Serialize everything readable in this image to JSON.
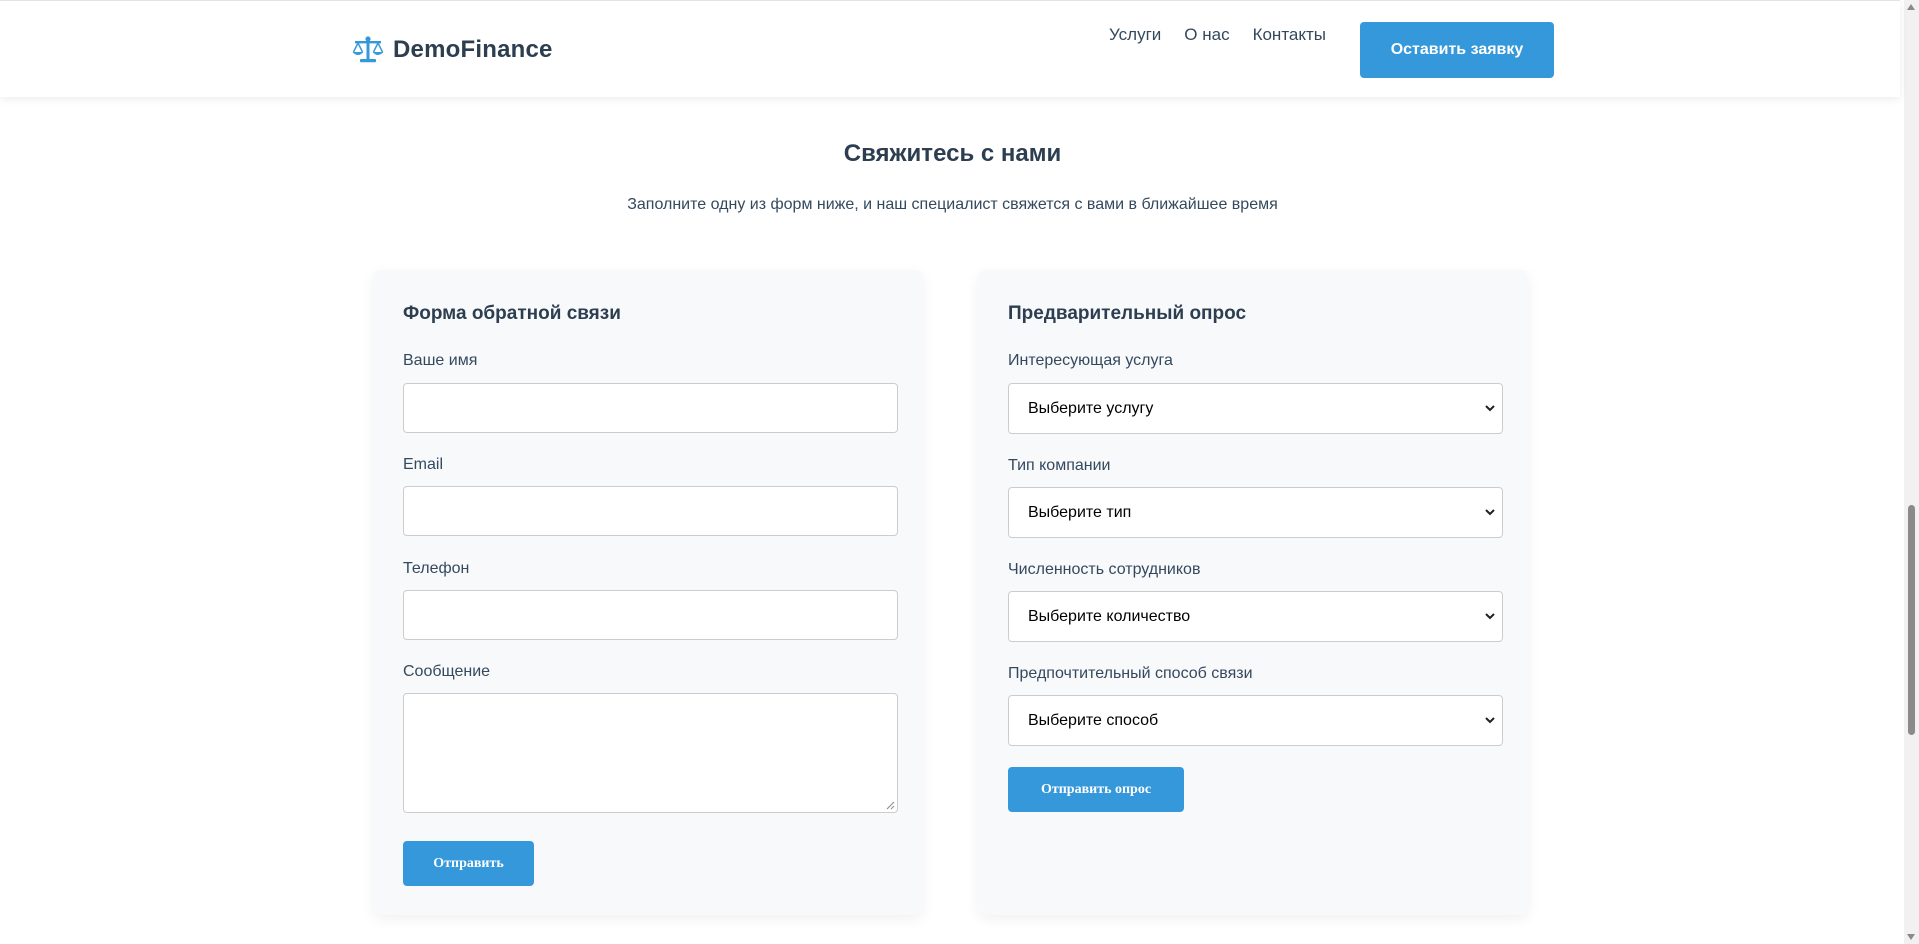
{
  "header": {
    "logo_text": "DemoFinance",
    "logo_icon": "balance-scale-icon",
    "nav": [
      {
        "label": "Услуги"
      },
      {
        "label": "О нас"
      },
      {
        "label": "Контакты"
      }
    ],
    "cta_label": "Оставить заявку"
  },
  "section": {
    "title": "Свяжитесь с нами",
    "subtitle": "Заполните одну из форм ниже, и наш специалист свяжется с вами в ближайшее время"
  },
  "feedback_form": {
    "title": "Форма обратной связи",
    "fields": {
      "name_label": "Ваше имя",
      "name_value": "",
      "email_label": "Email",
      "email_value": "",
      "phone_label": "Телефон",
      "phone_value": "",
      "message_label": "Сообщение",
      "message_value": ""
    },
    "submit_label": "Отправить"
  },
  "survey_form": {
    "title": "Предварительный опрос",
    "fields": {
      "service_label": "Интересующая услуга",
      "service_value": "Выберите услугу",
      "company_type_label": "Тип компании",
      "company_type_value": "Выберите тип",
      "employees_label": "Численность сотрудников",
      "employees_value": "Выберите количество",
      "contact_method_label": "Предпочтительный способ связи",
      "contact_method_value": "Выберите способ"
    },
    "submit_label": "Отправить опрос"
  },
  "colors": {
    "accent": "#3498db",
    "heading": "#2c3e50",
    "text": "#34495e",
    "card_background": "#f8f9fa",
    "input_border": "#cccccc"
  },
  "scroll": {
    "position_fraction": 0.72
  }
}
